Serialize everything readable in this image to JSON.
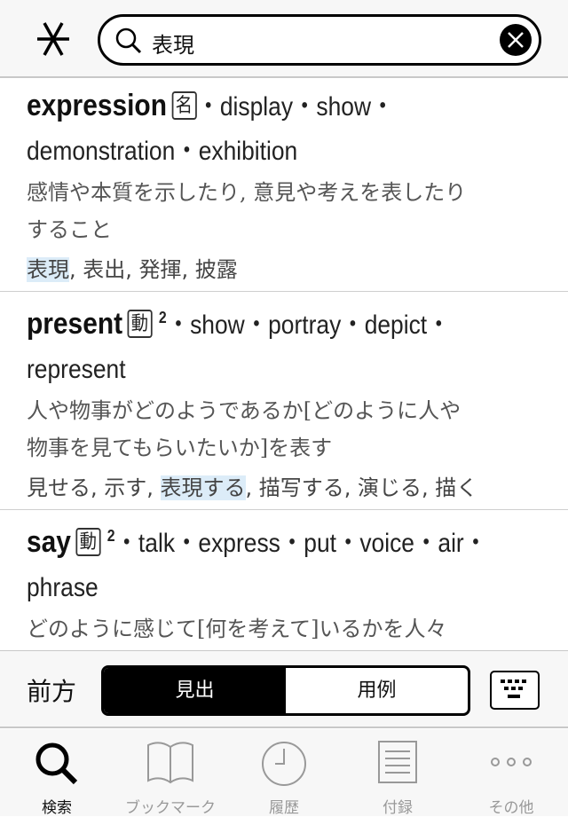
{
  "header": {
    "logo_icon": "asterisk-logo-icon",
    "search_value": "表現",
    "search_icon": "search-icon",
    "clear_icon": "close-icon"
  },
  "entries": [
    {
      "headword": "expression",
      "pos": "名",
      "sup": "",
      "translations_1": "・display・show・",
      "translations_2": "demonstration・exhibition",
      "definition_1": "感情や本質を示したり, 意見や考えを表したり",
      "definition_2": "すること",
      "synonyms": [
        {
          "text": "表現",
          "highlight": true
        },
        {
          "text": ", 表出, 発揮, 披露",
          "highlight": false
        }
      ]
    },
    {
      "headword": "present",
      "pos": "動",
      "sup": "2",
      "translations_1": "・show・portray・depict・",
      "translations_2": "represent",
      "definition_1": "人や物事がどのようであるか[どのように人や",
      "definition_2": "物事を見てもらいたいか]を表す",
      "synonyms": [
        {
          "text": "見せる, 示す, ",
          "highlight": false
        },
        {
          "text": "表現する",
          "highlight": true
        },
        {
          "text": ", 描写する, 演じる, 描く",
          "highlight": false
        }
      ]
    },
    {
      "headword": "say",
      "pos": "動",
      "sup": "2",
      "translations_1": "・talk・express・put・voice・air・",
      "translations_2": "phrase",
      "definition_1": "どのように感じて[何を考えて]いるかを人々",
      "definition_2": ""
    }
  ],
  "toolbar": {
    "direction": "前方",
    "segments": [
      {
        "label": "見出",
        "selected": true
      },
      {
        "label": "用例",
        "selected": false
      }
    ],
    "keyboard_icon": "keyboard-icon"
  },
  "tabs": [
    {
      "label": "検索",
      "icon": "search-icon",
      "active": true
    },
    {
      "label": "ブックマーク",
      "icon": "book-icon",
      "active": false
    },
    {
      "label": "履歴",
      "icon": "clock-icon",
      "active": false
    },
    {
      "label": "付録",
      "icon": "document-icon",
      "active": false
    },
    {
      "label": "その他",
      "icon": "more-icon",
      "active": false
    }
  ]
}
